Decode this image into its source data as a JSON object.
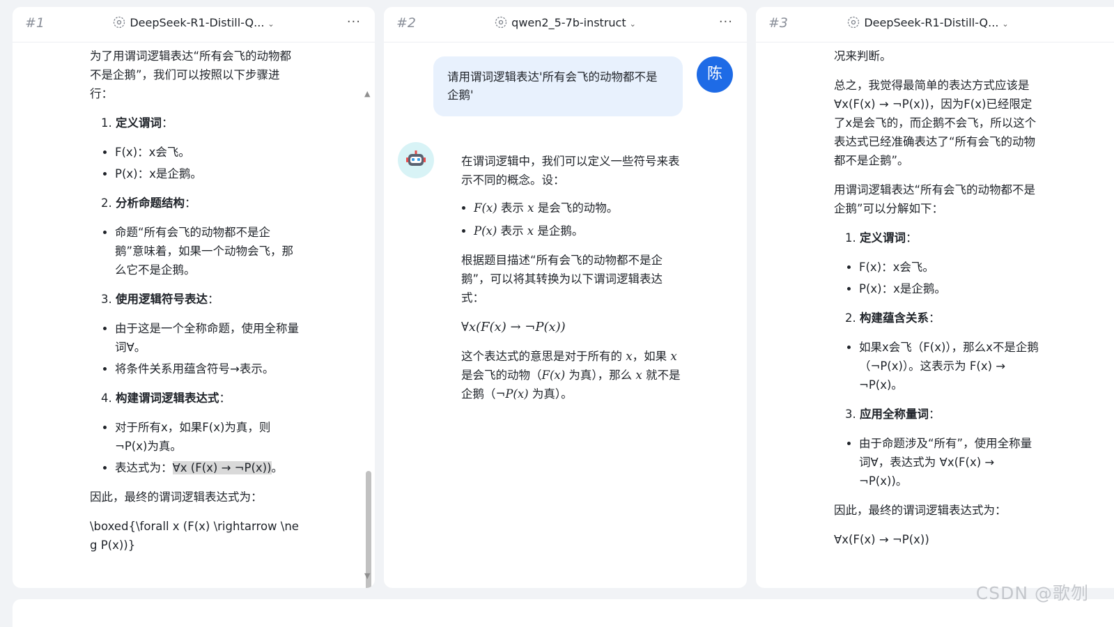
{
  "panels": [
    {
      "number": "#1",
      "model": "DeepSeek-R1-Distill-Q...",
      "more": "···"
    },
    {
      "number": "#2",
      "model": "qwen2_5-7b-instruct",
      "more": "···"
    },
    {
      "number": "#3",
      "model": "DeepSeek-R1-Distill-Q...",
      "more": "···"
    }
  ],
  "panel1": {
    "intro": "为了用谓词逻辑表达“所有会飞的动物都不是企鹅”，我们可以按照以下步骤进行：",
    "step1": {
      "n": "1.",
      "title": "定义谓词",
      "colon": "：",
      "items": [
        "F(x)：x会飞。",
        "P(x)：x是企鹅。"
      ]
    },
    "step2": {
      "n": "2.",
      "title": "分析命题结构",
      "colon": "：",
      "items": [
        "命题“所有会飞的动物都不是企鹅”意味着，如果一个动物会飞，那么它不是企鹅。"
      ]
    },
    "step3": {
      "n": "3.",
      "title": "使用逻辑符号表达",
      "colon": "：",
      "items": [
        "由于这是一个全称命题，使用全称量词∀。",
        "将条件关系用蕴含符号→表示。"
      ]
    },
    "step4": {
      "n": "4.",
      "title": "构建谓词逻辑表达式",
      "colon": "：",
      "items": [
        "对于所有x，如果F(x)为真，则¬P(x)为真。"
      ],
      "expr_prefix": "表达式为：",
      "expr": "∀x (F(x) → ¬P(x))",
      "expr_suffix": "。"
    },
    "conclusion": "因此，最终的谓词逻辑表达式为：",
    "boxed": "\\boxed{\\forall x (F(x) \\rightarrow \\neg P(x))}"
  },
  "panel2": {
    "user_message": "请用谓词逻辑表达'所有会飞的动物都不是企鹅'",
    "user_avatar": "陈",
    "intro": "在谓词逻辑中，我们可以定义一些符号来表示不同的概念。设：",
    "defs": [
      {
        "math": "F(x)",
        "pre": " 表示 ",
        "var": "x",
        "post": " 是会飞的动物。"
      },
      {
        "math": "P(x)",
        "pre": " 表示 ",
        "var": "x",
        "post": " 是企鹅。"
      }
    ],
    "para2": "根据题目描述“所有会飞的动物都不是企鹅”，可以将其转换为以下谓词逻辑表达式：",
    "formula": "∀x(F(x) → ¬P(x))",
    "explain": {
      "a": "这个表达式的意思是对于所有的 ",
      "x1": "x",
      "b": "，如果 ",
      "x2": "x",
      "c": " 是会飞的动物（",
      "f": "F(x)",
      "d": " 为真），那么 ",
      "x3": "x",
      "e": " 就不是企鹅（",
      "np": "¬P(x)",
      "g": " 为真）。"
    }
  },
  "panel3": {
    "top_fragment": "况来判断。",
    "para1": "总之，我觉得最简单的表达方式应该是∀x(F(x) → ¬P(x))，因为F(x)已经限定了x是会飞的，而企鹅不会飞，所以这个表达式已经准确表达了“所有会飞的动物都不是企鹅”。",
    "para2": "用谓词逻辑表达“所有会飞的动物都不是企鹅”可以分解如下：",
    "step1": {
      "n": "1.",
      "title": "定义谓词",
      "colon": "：",
      "items": [
        "F(x)：x会飞。",
        "P(x)：x是企鹅。"
      ]
    },
    "step2": {
      "n": "2.",
      "title": "构建蕴含关系",
      "colon": "：",
      "items": [
        "如果x会飞（F(x)），那么x不是企鹅（¬P(x)）。这表示为 F(x) → ¬P(x)。"
      ]
    },
    "step3": {
      "n": "3.",
      "title": "应用全称量词",
      "colon": "：",
      "items": [
        "由于命题涉及“所有”，使用全称量词∀，表达式为 ∀x(F(x) → ¬P(x))。"
      ]
    },
    "conclusion": "因此，最终的谓词逻辑表达式为：",
    "final": "∀x(F(x) → ¬P(x))"
  },
  "scroll": {
    "up": "▲",
    "down": "▼"
  },
  "watermark": "CSDN @歌刎",
  "colors": {
    "accent": "#1e6be6",
    "bubble": "#e8f1fd",
    "background": "#f1f3f6"
  }
}
